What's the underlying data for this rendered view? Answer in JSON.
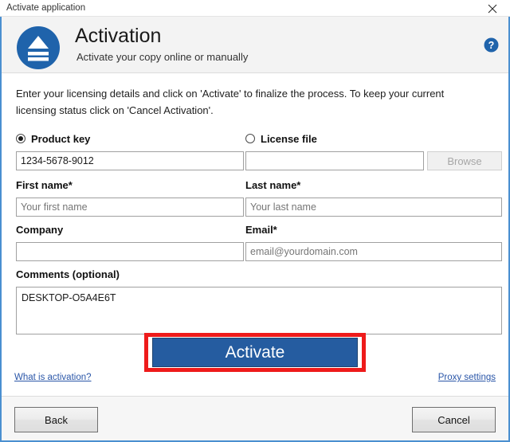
{
  "window": {
    "title": "Activate application",
    "close_icon": "close-icon"
  },
  "header": {
    "title": "Activation",
    "subtitle": "Activate your copy online or manually",
    "app_icon": "eject-disc-icon",
    "help_icon": "help-question-icon",
    "accent_color": "#1f63ab"
  },
  "body": {
    "intro": "Enter your licensing details and click on 'Activate' to finalize the process. To keep your current licensing status click on 'Cancel Activation'.",
    "license_mode": {
      "product_key": {
        "label": "Product key",
        "selected": true
      },
      "license_file": {
        "label": "License file",
        "selected": false
      }
    },
    "fields": {
      "product_key": {
        "value": "1234-5678-9012",
        "placeholder": ""
      },
      "license_file": {
        "value": "",
        "placeholder": ""
      },
      "browse_label": "Browse",
      "first_name": {
        "label": "First name*",
        "value": "",
        "placeholder": "Your first name"
      },
      "last_name": {
        "label": "Last name*",
        "value": "",
        "placeholder": "Your last name"
      },
      "company": {
        "label": "Company",
        "value": "",
        "placeholder": ""
      },
      "email": {
        "label": "Email*",
        "value": "",
        "placeholder": "email@yourdomain.com"
      },
      "comments": {
        "label": "Comments (optional)",
        "value": "DESKTOP-O5A4E6T",
        "placeholder": ""
      }
    },
    "activate_button": {
      "label": "Activate",
      "color": "#255ca0",
      "highlight_color": "#ee1b1b"
    },
    "links": {
      "what_is_activation": "What is activation?",
      "proxy_settings": "Proxy settings"
    }
  },
  "footer": {
    "back_label": "Back",
    "cancel_label": "Cancel"
  }
}
